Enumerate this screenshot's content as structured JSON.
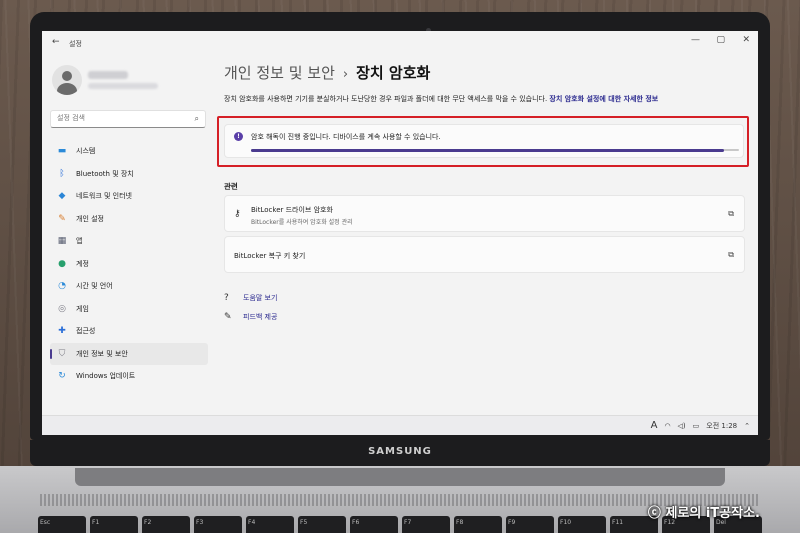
{
  "window": {
    "app_title": "설정",
    "back_label": "←",
    "minimize": "—",
    "maximize": "▢",
    "close": "✕"
  },
  "search": {
    "placeholder": "설정 검색",
    "icon": "search-icon"
  },
  "sidebar": {
    "items": [
      {
        "label": "시스템",
        "icon": "monitor-icon",
        "color": "#2b8ad8",
        "active": false
      },
      {
        "label": "Bluetooth 및 장치",
        "icon": "bluetooth-icon",
        "color": "#2b6fd8",
        "active": false
      },
      {
        "label": "네트워크 및 인터넷",
        "icon": "wifi-icon",
        "color": "#2a85d6",
        "active": false
      },
      {
        "label": "개인 설정",
        "icon": "brush-icon",
        "color": "#d87b2b",
        "active": false
      },
      {
        "label": "앱",
        "icon": "apps-icon",
        "color": "#555b6e",
        "active": false
      },
      {
        "label": "계정",
        "icon": "person-icon",
        "color": "#27a06d",
        "active": false
      },
      {
        "label": "시간 및 언어",
        "icon": "globe-clock-icon",
        "color": "#2b8ad8",
        "active": false
      },
      {
        "label": "게임",
        "icon": "gamepad-icon",
        "color": "#7b7b85",
        "active": false
      },
      {
        "label": "접근성",
        "icon": "accessibility-icon",
        "color": "#2b6fd8",
        "active": false
      },
      {
        "label": "개인 정보 및 보안",
        "icon": "shield-icon",
        "color": "#7b7b85",
        "active": true
      },
      {
        "label": "Windows 업데이트",
        "icon": "update-icon",
        "color": "#2b8ad8",
        "active": false
      }
    ]
  },
  "main": {
    "breadcrumb_parent": "개인 정보 및 보안",
    "breadcrumb_sep": "›",
    "breadcrumb_current": "장치 암호화",
    "description": "장치 암호화를 사용하면 기기를 분실하거나 도난당한 경우 파일과 폴더에 대한 무단 액세스를 막을 수 있습니다.",
    "description_link": "장치 암호화 설정에 대한 자세한 정보",
    "status_text": "암호 해독이 진행 중입니다. 디바이스를 계속 사용할 수 있습니다.",
    "progress": 0.97,
    "related_title": "관련",
    "related": [
      {
        "title": "BitLocker 드라이브 암호화",
        "subtitle": "BitLocker를 사용하여 암호화 설정 관리",
        "icon": "bitlocker-key-icon"
      },
      {
        "title": "BitLocker 복구 키 찾기",
        "subtitle": "",
        "icon": ""
      }
    ],
    "links": [
      {
        "label": "도움말 보기",
        "icon": "help-icon"
      },
      {
        "label": "피드백 제공",
        "icon": "feedback-icon"
      }
    ]
  },
  "taskbar": {
    "ime": "A",
    "time": "오전 1:28"
  },
  "device": {
    "brand": "SAMSUNG",
    "watermark": "ⓒ 제로의 iT공작소."
  },
  "keyboard": [
    "Esc",
    "F1",
    "F2",
    "F3",
    "F4",
    "F5",
    "F6",
    "F7",
    "F8",
    "F9",
    "F10",
    "F11",
    "F12",
    "Del"
  ]
}
